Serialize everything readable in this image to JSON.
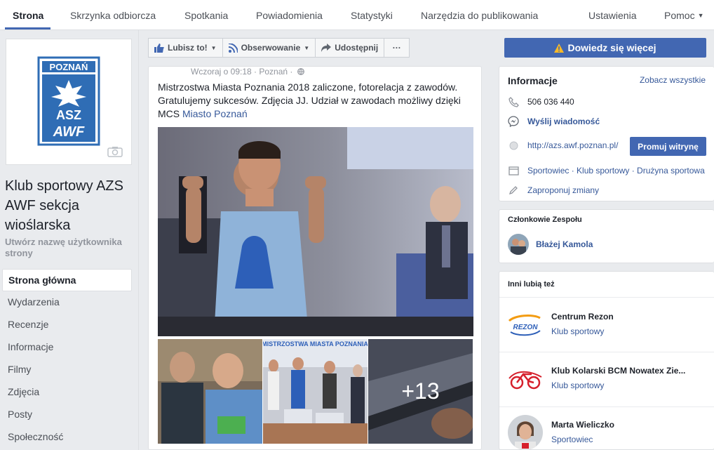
{
  "nav": {
    "tabs": [
      "Strona",
      "Skrzynka odbiorcza",
      "Spotkania",
      "Powiadomienia",
      "Statystyki",
      "Narzędzia do publikowania",
      "Ustawienia",
      "Pomoc"
    ]
  },
  "left": {
    "logo_text_top": "POZNAŃ",
    "logo_text_mid": "ASZ",
    "logo_text_bot": "AWF",
    "page_name": "Klub sportowy AZS AWF sekcja wioślarska",
    "username_prompt": "Utwórz nazwę użytkownika strony",
    "menu": [
      "Strona główna",
      "Wydarzenia",
      "Recenzje",
      "Informacje",
      "Filmy",
      "Zdjęcia",
      "Posty",
      "Społeczność"
    ]
  },
  "actions": {
    "like": "Lubisz to!",
    "follow": "Obserwowanie",
    "share": "Udostępnij",
    "more": "···",
    "learn_more": "Dowiedz się więcej"
  },
  "post": {
    "meta": "Wczoraj o 09:18 · Poznań ·",
    "text": "Mistrzostwa Miasta Poznania 2018 zaliczone, fotorelacja z zawodów. Gratulujemy sukcesów. Zdjęcia JJ. Udział w zawodach możliwy dzięki MCS ",
    "link": "Miasto Poznań",
    "more_photos": "+13",
    "banner_text": "MISTRZOSTWA MIASTA POZNANIA"
  },
  "info": {
    "title": "Informacje",
    "see_all": "Zobacz wszystkie",
    "phone": "506 036 440",
    "message": "Wyślij wiadomość",
    "website": "http://azs.awf.poznan.pl/",
    "promote": "Promuj witrynę",
    "categories": "Sportowiec · Klub sportowy · Drużyna sportowa",
    "suggest": "Zaproponuj zmiany"
  },
  "team": {
    "title": "Członkowie Zespołu",
    "member": "Błażej Kamola"
  },
  "also_liked": {
    "title": "Inni lubią też",
    "items": [
      {
        "name": "Centrum Rezon",
        "category": "Klub sportowy",
        "logo_text": "REZON"
      },
      {
        "name": "Klub Kolarski BCM Nowatex Zie...",
        "category": "Klub sportowy"
      },
      {
        "name": "Marta Wieliczko",
        "category": "Sportowiec"
      }
    ]
  },
  "colors": {
    "brand": "#4267b2",
    "link": "#365899",
    "bg": "#e9ebee",
    "learn_more_warning": "#f7b928"
  }
}
